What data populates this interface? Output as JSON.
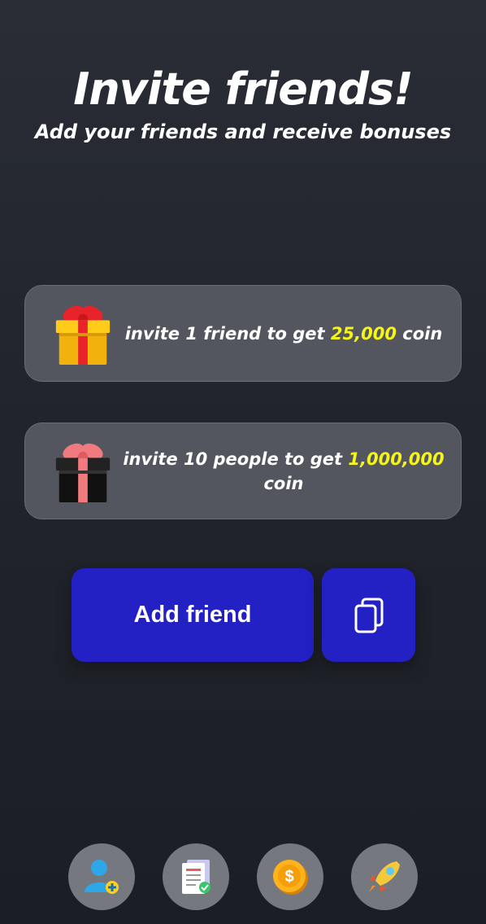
{
  "header": {
    "title": "Invite friends!",
    "subtitle": "Add your friends and receive bonuses"
  },
  "rewards": [
    {
      "text_before": "invite 1 friend to get ",
      "amount": "25,000",
      "text_after": " coin",
      "icon": "yellow-gift-icon"
    },
    {
      "text_before": "invite 10 people to get ",
      "amount": "1,000,000",
      "text_after": " coin",
      "icon": "black-gift-icon"
    }
  ],
  "actions": {
    "add_friend_label": "Add friend",
    "copy_icon": "copy-icon"
  },
  "bottom_nav": [
    {
      "icon": "add-user-icon"
    },
    {
      "icon": "task-list-icon"
    },
    {
      "icon": "coin-icon"
    },
    {
      "icon": "rocket-icon"
    }
  ],
  "colors": {
    "accent_button": "#2320c4",
    "highlight": "#f5f51a",
    "card_bg": "#53565e"
  }
}
